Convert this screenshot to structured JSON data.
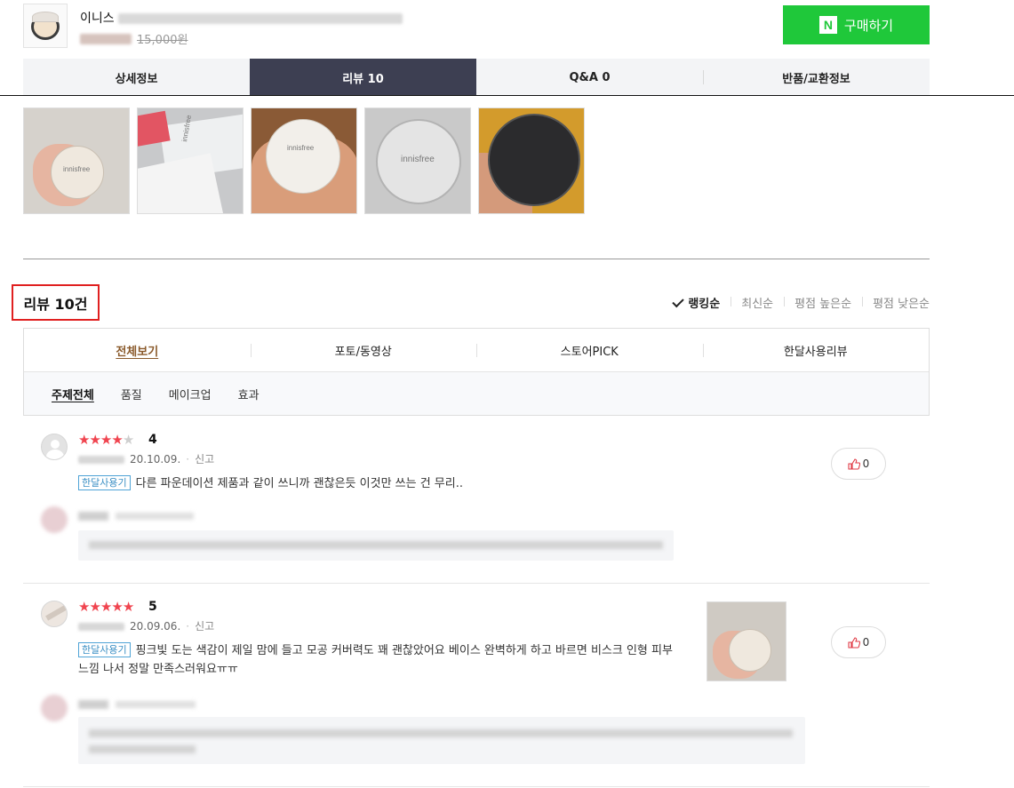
{
  "product": {
    "name_prefix": "이니스",
    "original_price": "15,000원",
    "buy_label": "구매하기",
    "naver_logo": "N"
  },
  "tabs": [
    {
      "label": "상세정보"
    },
    {
      "label": "리뷰 10"
    },
    {
      "label": "Q&A 0"
    },
    {
      "label": "반품/교환정보"
    }
  ],
  "photos": [
    {
      "label": "innisfree"
    },
    {
      "label": "innisfree"
    },
    {
      "label": "innisfree"
    },
    {
      "label": "innisfree"
    },
    {
      "label": ""
    }
  ],
  "review_section": {
    "title": "리뷰 10건",
    "sort_options": [
      "랭킹순",
      "최신순",
      "평점 높은순",
      "평점 낮은순"
    ],
    "filters": [
      "전체보기",
      "포토/동영상",
      "스토어PICK",
      "한달사용리뷰"
    ],
    "topics": [
      "주제전체",
      "품질",
      "메이크업",
      "효과"
    ]
  },
  "reviews": [
    {
      "rating": 4,
      "score_text": "4",
      "date": "20.10.09.",
      "report": "신고",
      "badge": "한달사용기",
      "text": "다른 파운데이션 제품과 같이 쓰니까 괜찮은듯 이것만 쓰는 건 무리..",
      "likes": "0"
    },
    {
      "rating": 5,
      "score_text": "5",
      "date": "20.09.06.",
      "report": "신고",
      "badge": "한달사용기",
      "text": "핑크빛 도는 색감이 제일 맘에 들고 모공 커버력도 꽤 괜찮았어요 베이스 완벽하게 하고 바르면 비스크 인형 피부 느낌 나서 정말 만족스러워요ㅠㅠ",
      "likes": "0"
    }
  ],
  "colors": {
    "buy_green": "#1fc83a",
    "active_tab": "#3d3f52",
    "star_red": "#f0444f",
    "highlight_border": "#e02020",
    "badge_blue": "#3b8fc4"
  },
  "icons": {
    "sort_check": "check-icon",
    "like": "thumbs-up-icon",
    "default_avatar": "user-avatar-icon"
  }
}
